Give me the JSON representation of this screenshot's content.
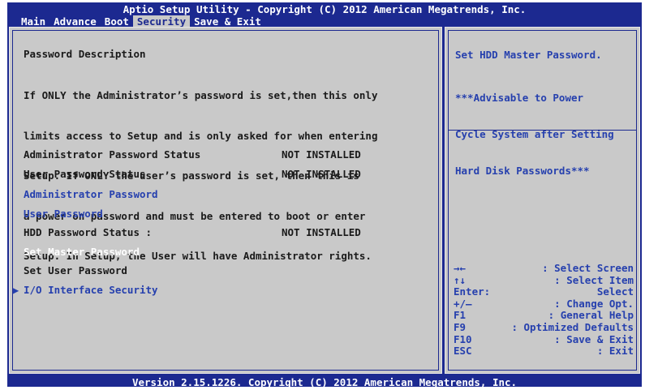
{
  "title": "Aptio Setup Utility - Copyright (C) 2012 American Megatrends, Inc.",
  "menu": [
    "Main",
    "Advance",
    "Boot",
    "Security",
    "Save & Exit"
  ],
  "active_menu": "Security",
  "description": {
    "heading": "Password Description",
    "lines": [
      "If ONLY the Administrator’s password is set,then this only",
      "limits access to Setup and is only asked for when entering",
      "Setup. If ONLY the user’s password is set, then this is",
      "a power on password and must be entered to boot or enter",
      "Setup. In Setup, the User will have Administrator rights."
    ]
  },
  "items": {
    "admin_status": {
      "label": "Administrator Password Status",
      "value": "NOT INSTALLED"
    },
    "user_status": {
      "label": "User Password Status",
      "value": "NOT INSTALLED"
    },
    "admin_password": {
      "label": "Administrator Password"
    },
    "user_password": {
      "label": "User Password"
    },
    "hdd_status": {
      "label": "HDD Password Status :",
      "value": "NOT INSTALLED"
    },
    "set_master": {
      "label": "Set Master Password"
    },
    "set_user": {
      "label": "Set User Password"
    },
    "io_security": {
      "label": "I/O Interface Security"
    }
  },
  "help": {
    "title": "Set HDD Master Password.",
    "note_lines": [
      "***Advisable to Power",
      "Cycle System after Setting",
      "Hard Disk Passwords***"
    ]
  },
  "keys": [
    {
      "key": "→←",
      "desc": ": Select Screen"
    },
    {
      "key": "↑↓",
      "desc": ": Select Item"
    },
    {
      "key": "Enter:",
      "desc": "Select"
    },
    {
      "key": "+/—",
      "desc": ": Change Opt."
    },
    {
      "key": "F1",
      "desc": ": General Help"
    },
    {
      "key": "F9",
      "desc": ": Optimized Defaults"
    },
    {
      "key": "F10",
      "desc": ": Save & Exit"
    },
    {
      "key": "ESC",
      "desc": ": Exit"
    }
  ],
  "status_bar": "Version 2.15.1226. Copyright (C) 2012 American Megatrends, Inc.",
  "colors": {
    "background": "#1c2990",
    "panel": "#c9c9c9",
    "accent": "#2640ae",
    "text": "#1a1a1a"
  }
}
